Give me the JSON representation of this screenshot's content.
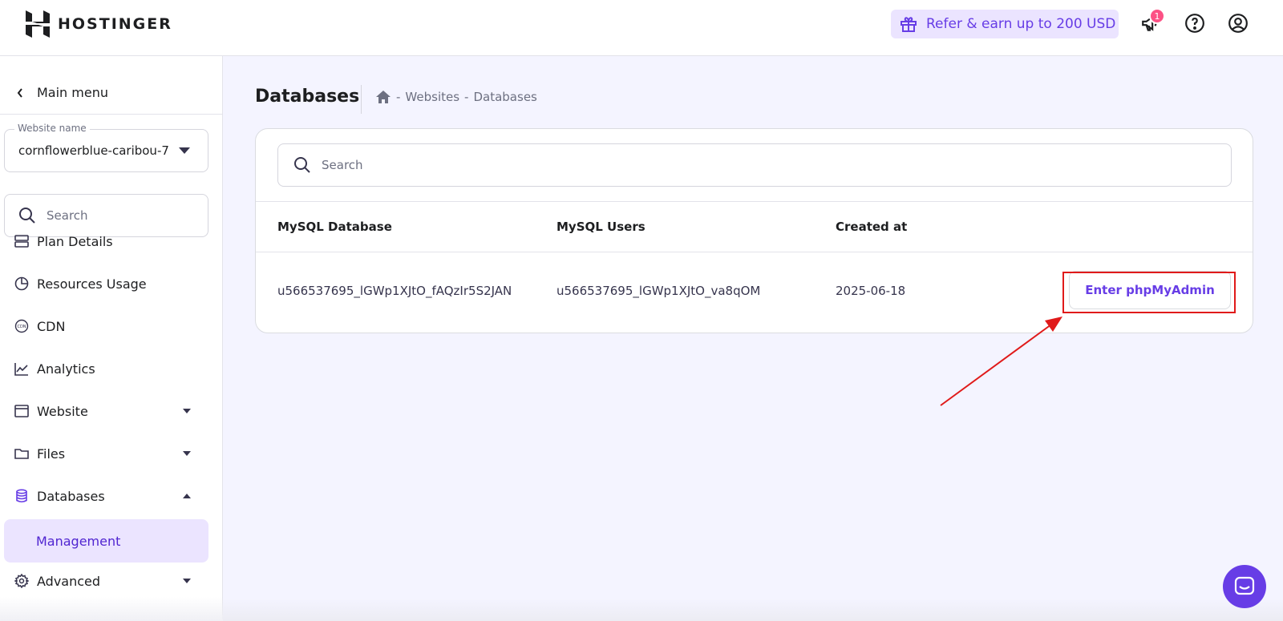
{
  "header": {
    "logo_text": "HOSTINGER",
    "refer_label": "Refer & earn up to 200 USD",
    "notification_count": "1"
  },
  "sidebar": {
    "main_menu_label": "Main menu",
    "website_name_label": "Website name",
    "website_name_value": "cornflowerblue-caribou-7",
    "search_placeholder": "Search",
    "items": [
      {
        "label": "Plan Details",
        "icon": "server-icon"
      },
      {
        "label": "Resources Usage",
        "icon": "pie-chart-icon"
      },
      {
        "label": "CDN",
        "icon": "cdn-icon"
      },
      {
        "label": "Analytics",
        "icon": "analytics-icon"
      },
      {
        "label": "Website",
        "icon": "browser-window-icon"
      },
      {
        "label": "Files",
        "icon": "folder-icon"
      },
      {
        "label": "Databases",
        "icon": "database-icon"
      },
      {
        "label": "Management",
        "icon": ""
      },
      {
        "label": "Advanced",
        "icon": "gear-icon"
      }
    ]
  },
  "main": {
    "title": "Databases",
    "breadcrumb": [
      "Websites",
      "Databases"
    ],
    "search_placeholder": "Search",
    "table": {
      "headers": [
        "MySQL Database",
        "MySQL Users",
        "Created at"
      ],
      "rows": [
        {
          "database": "u566537695_lGWp1XJtO_fAQzIr5S2JAN",
          "user": "u566537695_lGWp1XJtO_va8qOM",
          "created": "2025-06-18",
          "action": "Enter phpMyAdmin"
        }
      ]
    }
  },
  "colors": {
    "accent": "#673de6",
    "accent_light": "#ebe4ff",
    "highlight_red": "#e01a1a",
    "background": "#f4f4ff"
  }
}
